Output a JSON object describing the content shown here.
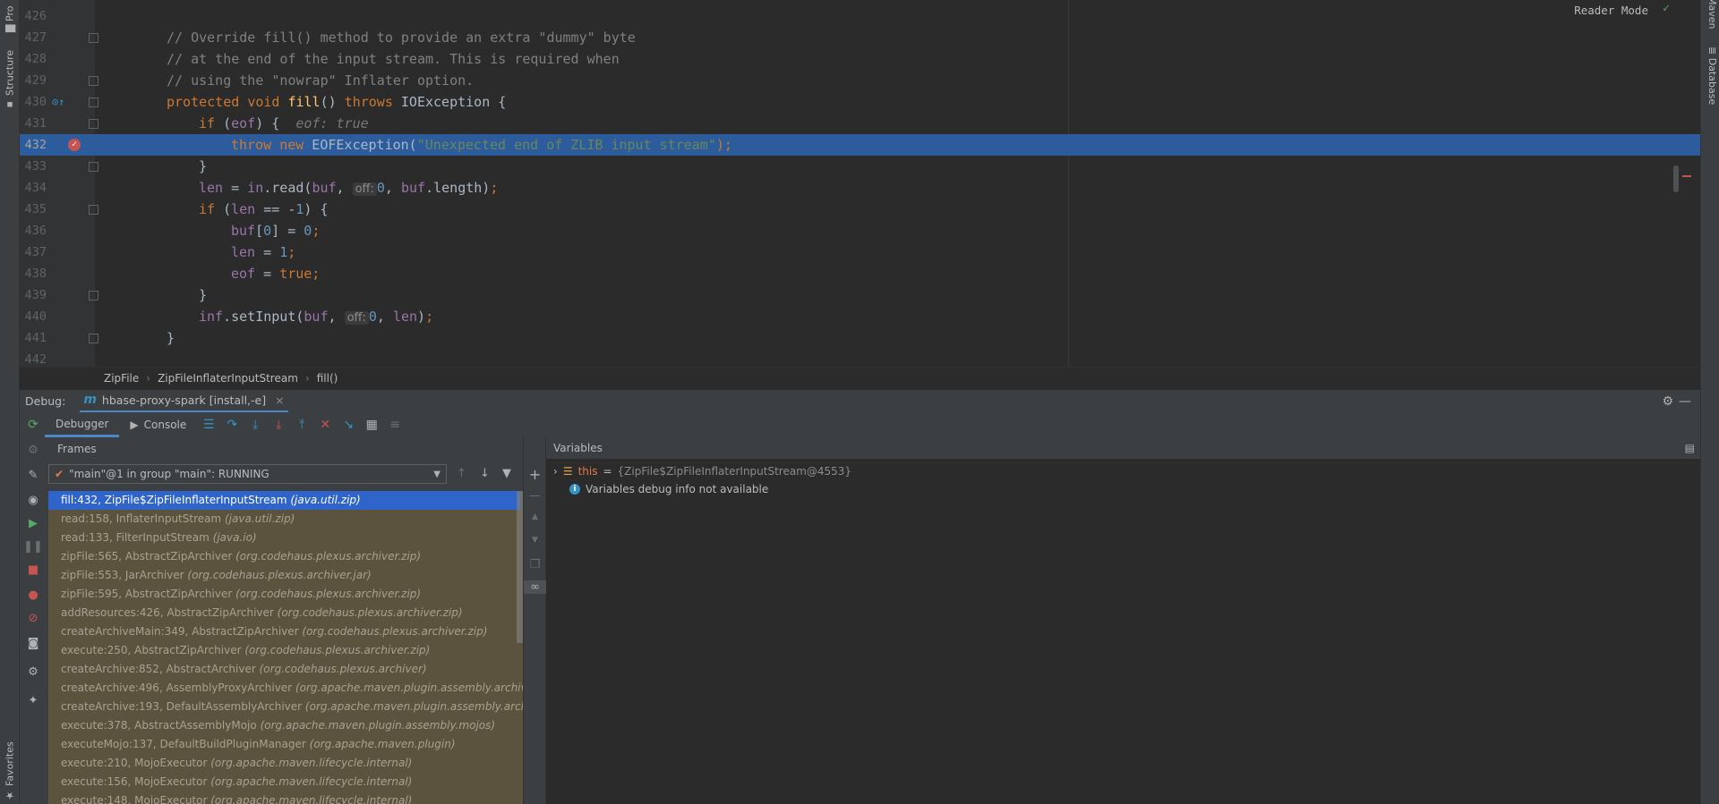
{
  "left_strip": {
    "project_label": "Pro",
    "structure_label": "Structure",
    "favorites_label": "Favorites"
  },
  "right_strip": {
    "maven_label": "Maven",
    "database_label": "Database"
  },
  "editor": {
    "reader_mode": "Reader Mode",
    "lines": [
      {
        "num": "426"
      },
      {
        "num": "427",
        "comment": "// Override fill() method to provide an extra \"dummy\" byte"
      },
      {
        "num": "428",
        "comment": "// at the end of the input stream. This is required when"
      },
      {
        "num": "429",
        "comment": "// using the \"nowrap\" Inflater option."
      },
      {
        "num": "430",
        "k1": "protected",
        "k2": "void",
        "fn": "fill",
        "p1": "() ",
        "k3": "throws",
        "rest": " IOException {"
      },
      {
        "num": "431",
        "k1": "if",
        "p1": " (",
        "f1": "eof",
        "p2": ") {  ",
        "hint": "eof: true"
      },
      {
        "num": "432",
        "k1": "throw",
        "k2": "new",
        "p1": " EOFException(",
        "str": "\"Unexpected end of ZLIB input stream\"",
        "p2": ");"
      },
      {
        "num": "433",
        "p1": "}"
      },
      {
        "num": "434",
        "f1": "len",
        "p1": " = ",
        "f2": "in",
        "p2": ".read(",
        "f3": "buf",
        "p3": ", ",
        "inlay": "off:",
        "n1": "0",
        "p4": ", ",
        "f4": "buf",
        "p5": ".length)",
        "k1": ";"
      },
      {
        "num": "435",
        "k1": "if",
        "p1": " (",
        "f1": "len",
        "p2": " == -",
        "n1": "1",
        "p3": ") {"
      },
      {
        "num": "436",
        "f1": "buf",
        "p1": "[",
        "n1": "0",
        "p2": "] = ",
        "n2": "0",
        "k1": ";"
      },
      {
        "num": "437",
        "f1": "len",
        "p1": " = ",
        "n1": "1",
        "k1": ";"
      },
      {
        "num": "438",
        "f1": "eof",
        "p1": " = ",
        "k1": "true;"
      },
      {
        "num": "439",
        "p1": "}"
      },
      {
        "num": "440",
        "f1": "inf",
        "p1": ".setInput(",
        "f2": "buf",
        "p2": ", ",
        "inlay": "off:",
        "n1": "0",
        "p3": ", ",
        "f3": "len",
        "p4": ")",
        "k1": ";"
      },
      {
        "num": "441",
        "p1": "}"
      },
      {
        "num": "442"
      }
    ]
  },
  "breadcrumb": [
    "ZipFile",
    "ZipFileInflaterInputStream",
    "fill()"
  ],
  "debug": {
    "label": "Debug:",
    "session": "hbase-proxy-spark [install,-e]",
    "tabs": {
      "debugger": "Debugger",
      "console": "Console"
    },
    "frames_title": "Frames",
    "thread": "\"main\"@1 in group \"main\": RUNNING",
    "frames": [
      {
        "m": "fill:432, ZipFile$ZipFileInflaterInputStream",
        "p": "(java.util.zip)"
      },
      {
        "m": "read:158, InflaterInputStream",
        "p": "(java.util.zip)"
      },
      {
        "m": "read:133, FilterInputStream",
        "p": "(java.io)"
      },
      {
        "m": "zipFile:565, AbstractZipArchiver",
        "p": "(org.codehaus.plexus.archiver.zip)"
      },
      {
        "m": "zipFile:553, JarArchiver",
        "p": "(org.codehaus.plexus.archiver.jar)"
      },
      {
        "m": "zipFile:595, AbstractZipArchiver",
        "p": "(org.codehaus.plexus.archiver.zip)"
      },
      {
        "m": "addResources:426, AbstractZipArchiver",
        "p": "(org.codehaus.plexus.archiver.zip)"
      },
      {
        "m": "createArchiveMain:349, AbstractZipArchiver",
        "p": "(org.codehaus.plexus.archiver.zip)"
      },
      {
        "m": "execute:250, AbstractZipArchiver",
        "p": "(org.codehaus.plexus.archiver.zip)"
      },
      {
        "m": "createArchive:852, AbstractArchiver",
        "p": "(org.codehaus.plexus.archiver)"
      },
      {
        "m": "createArchive:496, AssemblyProxyArchiver",
        "p": "(org.apache.maven.plugin.assembly.archive.archiver)"
      },
      {
        "m": "createArchive:193, DefaultAssemblyArchiver",
        "p": "(org.apache.maven.plugin.assembly.archive)"
      },
      {
        "m": "execute:378, AbstractAssemblyMojo",
        "p": "(org.apache.maven.plugin.assembly.mojos)"
      },
      {
        "m": "executeMojo:137, DefaultBuildPluginManager",
        "p": "(org.apache.maven.plugin)"
      },
      {
        "m": "execute:210, MojoExecutor",
        "p": "(org.apache.maven.lifecycle.internal)"
      },
      {
        "m": "execute:156, MojoExecutor",
        "p": "(org.apache.maven.lifecycle.internal)"
      },
      {
        "m": "execute:148, MojoExecutor",
        "p": "(org.apache.maven.lifecycle.internal)"
      }
    ],
    "variables_title": "Variables",
    "variables": [
      {
        "name": "this",
        "eq": "=",
        "value": "{ZipFile$ZipFileInflaterInputStream@4553}"
      },
      {
        "info": "Variables debug info not available"
      }
    ]
  },
  "colors": {
    "accent": "#2d5c9c",
    "selection": "#2f65ca",
    "frames_bg": "#5c533f"
  }
}
